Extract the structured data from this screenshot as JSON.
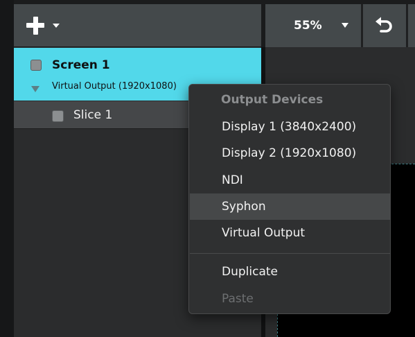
{
  "toolbar": {
    "add_icon": "plus-icon",
    "zoom_value": "55%",
    "undo_icon": "undo-arrow-icon"
  },
  "layers": {
    "screen": {
      "name": "Screen 1",
      "output": "Virtual Output (1920x1080)"
    },
    "slice": {
      "name": "Slice 1"
    }
  },
  "context_menu": {
    "header": "Output Devices",
    "items": [
      {
        "label": "Display 1 (3840x2400)"
      },
      {
        "label": "Display 2 (1920x1080)"
      },
      {
        "label": "NDI"
      },
      {
        "label": "Syphon"
      },
      {
        "label": "Virtual Output"
      }
    ],
    "actions": [
      {
        "label": "Duplicate"
      },
      {
        "label": "Paste"
      }
    ]
  },
  "colors": {
    "selection": "#52d8ea",
    "toolbar": "#44494b",
    "menu_highlight": "#464849"
  }
}
